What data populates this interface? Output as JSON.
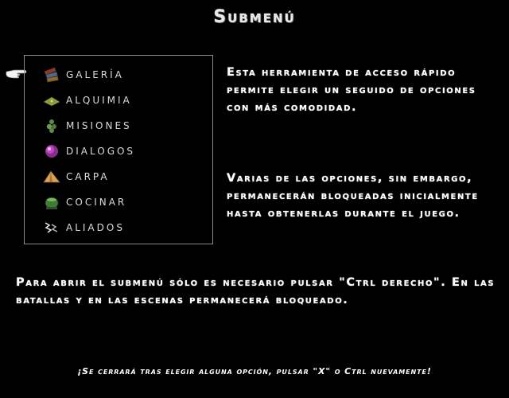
{
  "title": "Submenú",
  "menu": {
    "items": [
      {
        "label": "Galería",
        "icon": "books-icon"
      },
      {
        "label": "Alquimia",
        "icon": "alchemy-icon"
      },
      {
        "label": "Misiones",
        "icon": "missions-icon"
      },
      {
        "label": "Dialogos",
        "icon": "dialog-orb-icon"
      },
      {
        "label": "Carpa",
        "icon": "tent-icon"
      },
      {
        "label": "Cocinar",
        "icon": "cooking-pot-icon"
      },
      {
        "label": "Aliados",
        "icon": "allies-icon"
      }
    ],
    "selected_index": 0,
    "pointer_icon": "hand-pointer-icon"
  },
  "paragraphs": {
    "p1": "Esta herramienta de acceso rápido permite elegir un seguido de opciones con más comodidad.",
    "p2": "Varias de las opciones, sin embargo, permanecerán bloqueadas inicialmente hasta obtenerlas durante el juego.",
    "p3": "Para abrir el submenú sólo es necesario pulsar \"Ctrl derecho\". En las batallas y en las escenas permanecerá bloqueado."
  },
  "footer": "¡Se cerrará tras elegir alguna opción, pulsar \"X\" o Ctrl nuevamente!",
  "colors": {
    "background": "#000000",
    "text": "#ffffff",
    "border": "#8a8a8a"
  }
}
